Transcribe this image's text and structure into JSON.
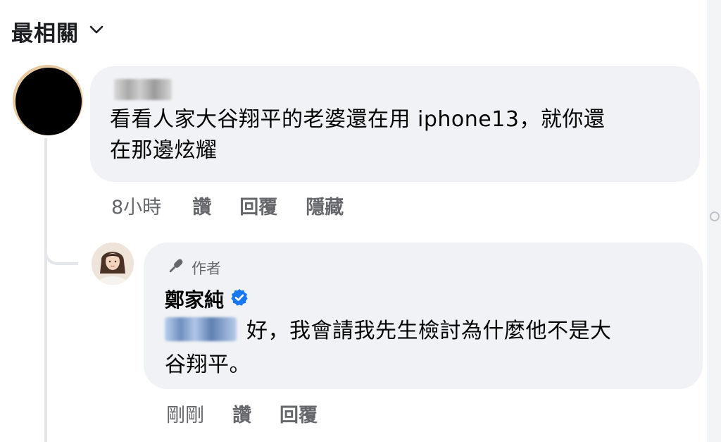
{
  "sort": {
    "label": "最相關",
    "icon": "chevron-down-icon"
  },
  "comment": {
    "text_line1": "看看人家大谷翔平的老婆還在用 iphone13，就你還",
    "text_line2": "在那邊炫耀",
    "timestamp": "8小時",
    "actions": {
      "like": "讚",
      "reply": "回覆",
      "hide": "隱藏"
    }
  },
  "reply": {
    "badge_label": "作者",
    "badge_icon": "microphone-icon",
    "author_name": "鄭家純",
    "verified_icon": "verified-badge-icon",
    "verified_color": "#1877f2",
    "text_line1": "好，我會請我先生檢討為什麼他不是大",
    "text_line2": "谷翔平。",
    "timestamp": "剛剛",
    "actions": {
      "like": "讚",
      "reply": "回覆"
    }
  },
  "colors": {
    "bubble_bg": "#f0f2f5",
    "muted_text": "#65676b",
    "thread_line": "#e4e6ea"
  }
}
